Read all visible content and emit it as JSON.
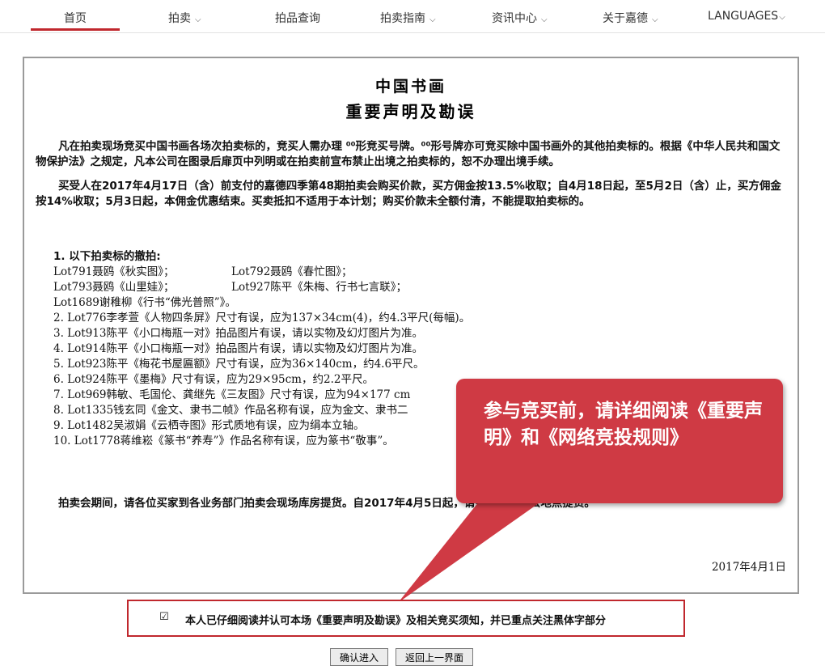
{
  "nav": {
    "items": [
      {
        "label": "首页",
        "dropdown": false
      },
      {
        "label": "拍卖",
        "dropdown": true
      },
      {
        "label": "拍品查询",
        "dropdown": false
      },
      {
        "label": "拍卖指南",
        "dropdown": true
      },
      {
        "label": "资讯中心",
        "dropdown": true
      },
      {
        "label": "关于嘉德",
        "dropdown": true
      },
      {
        "label": "LANGUAGES",
        "dropdown": true
      }
    ],
    "active": "首页",
    "accent": "#c0272d"
  },
  "doc": {
    "title_main": "中国书画",
    "title_sub": "重要声明及勘误",
    "para1": "凡在拍卖现场竞买中国书画各场次拍卖标的，竞买人需办理 ⁰⁰形竞买号牌。⁰⁰形号牌亦可竞买除中国书画外的其他拍卖标的。根据《中华人民共和国文物保护法》之规定，凡本公司在图录后扉页中列明或在拍卖前宣布禁止出境之拍卖标的，恕不办理出境手续。",
    "para2": "买受人在2017年4月17日（含）前支付的嘉德四季第48期拍卖会购买价款，买方佣金按13.5%收取；自4月18日起，至5月2日（含）止，买方佣金按14%收取；5月3日起，本佣金优惠结束。买卖抵扣不适用于本计划；购买价款未全额付清，不能提取拍卖标的。",
    "list_intro": "1.   以下拍卖标的撤拍:",
    "withdrawn": [
      {
        "a": "Lot791聂鸥《秋实图》；",
        "b": "Lot792聂鸥《春忙图》；"
      },
      {
        "a": "Lot793聂鸥《山里娃》；",
        "b": "Lot927陈平《朱梅、行书七言联》；"
      },
      {
        "a": "Lot1689谢稚柳《行书“佛光普照”》。",
        "b": ""
      }
    ],
    "errata": [
      "2.   Lot776李孝萱《人物四条屏》尺寸有误，应为137×34cm(4)，约4.3平尺(每幅)。",
      "3.   Lot913陈平《小口梅瓶一对》拍品图片有误，请以实物及幻灯图片为准。",
      "4.   Lot914陈平《小口梅瓶一对》拍品图片有误，请以实物及幻灯图片为准。",
      "5.   Lot923陈平《梅花书屋匾额》尺寸有误，应为36×140cm，约4.6平尺。",
      "6.   Lot924陈平《墨梅》尺寸有误，应为29×95cm，约2.2平尺。",
      "7.   Lot969韩敏、毛国伦、龚继先《三友图》尺寸有误，应为94×177 cm",
      "8.   Lot1335钱玄同《金文、隶书二帧》作品名称有误，应为金文、隶书二",
      "9.   Lot1482吴淑娟《云栖寺图》形式质地有误，应为绢本立轴。",
      "10. Lot1778蒋维崧《篆书“养寿”》作品名称有误，应为篆书“敬事”。"
    ],
    "para3": "拍卖会期间，请各位买家到各业务部门拍卖会现场库房提货。自2017年4月5日起，请到本公司办公地点提货。",
    "date": "2017年4月1日"
  },
  "callout": {
    "text": "参与竞买前，请详细阅读《重要声明》和《网络竞投规则》",
    "color": "#cf3a44"
  },
  "agreement": {
    "checked": true,
    "check_glyph": "☑",
    "text": "本人已仔细阅读并认可本场《重要声明及勘误》及相关竞买须知，并已重点关注黑体字部分"
  },
  "buttons": {
    "confirm": "确认进入",
    "back": "返回上一界面"
  }
}
